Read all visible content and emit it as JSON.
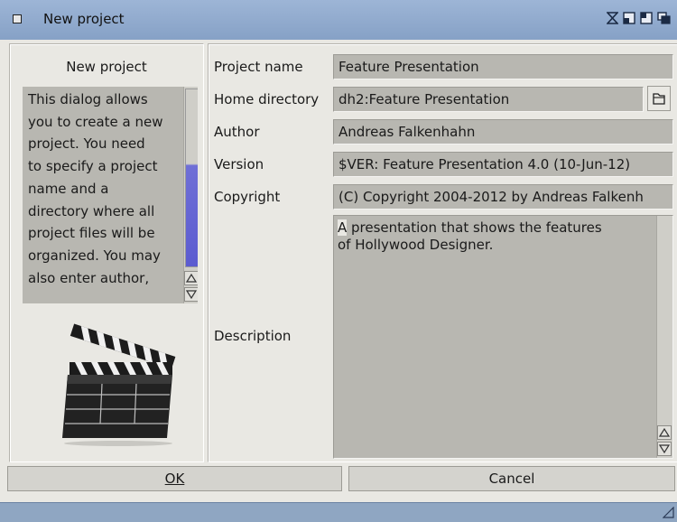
{
  "window": {
    "title": "New project"
  },
  "left": {
    "heading": "New project",
    "info_lines": [
      "This dialog allows",
      "you to create a new",
      "project. You need",
      "to specify a project",
      "name and a",
      "directory where all",
      "project files will be",
      "organized. You may",
      "also enter author,"
    ]
  },
  "form": {
    "project_name_label": "Project name",
    "project_name_value": "Feature Presentation",
    "home_dir_label": "Home directory",
    "home_dir_value": "dh2:Feature Presentation",
    "author_label": "Author",
    "author_value": "Andreas Falkenhahn",
    "version_label": "Version",
    "version_value": "$VER: Feature Presentation 4.0 (10-Jun-12)",
    "copyright_label": "Copyright",
    "copyright_value": "(C) Copyright 2004-2012 by Andreas Falkenh",
    "description_label": "Description",
    "description_first_char": "A",
    "description_rest": " presentation that shows the features\nof Hollywood Designer."
  },
  "buttons": {
    "ok_label": "OK",
    "cancel_label": "Cancel"
  },
  "icons": {
    "close": "close-gadget-icon",
    "iconify": "iconify-icon",
    "zoom": "zoom-icon",
    "depth": "depth-icon",
    "folder": "folder-icon",
    "clapperboard": "clapperboard-icon"
  },
  "colors": {
    "titlebar": "#8fa6c2",
    "window_bg": "#e9e8e3",
    "field_bg": "#b8b7b1",
    "scroll_knob": "#5b5bd0"
  }
}
